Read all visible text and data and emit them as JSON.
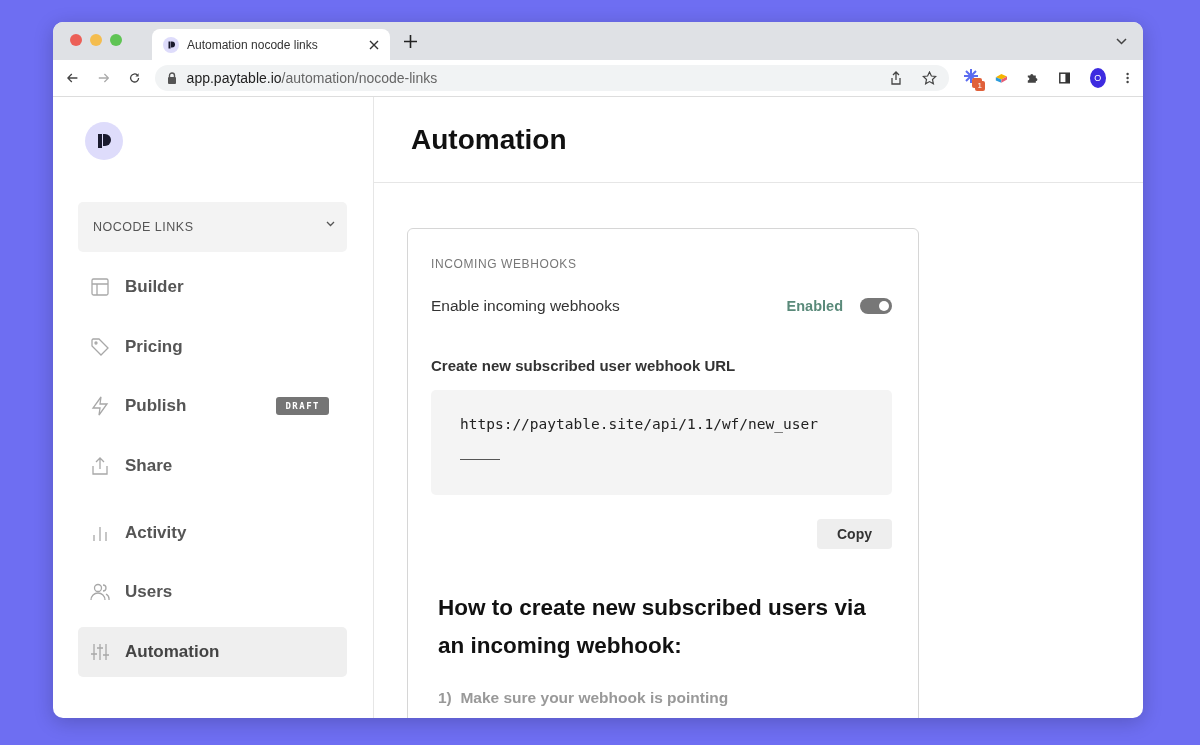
{
  "browser": {
    "tab_title": "Automation nocode links",
    "url_host": "app.paytable.io",
    "url_path": "/automation/nocode-links",
    "extension_badge": "1",
    "profile_initial": "O"
  },
  "sidebar": {
    "workspace": "NOCODE LINKS",
    "groups": [
      [
        {
          "label": "Builder",
          "selected": false
        },
        {
          "label": "Pricing",
          "selected": false
        },
        {
          "label": "Publish",
          "selected": false,
          "badge": "DRAFT"
        },
        {
          "label": "Share",
          "selected": false
        }
      ],
      [
        {
          "label": "Activity",
          "selected": false
        },
        {
          "label": "Users",
          "selected": false
        },
        {
          "label": "Automation",
          "selected": true
        }
      ]
    ]
  },
  "page": {
    "title": "Automation",
    "card": {
      "section_title": "INCOMING WEBHOOKS",
      "toggle_label": "Enable incoming webhooks",
      "toggle_status": "Enabled",
      "toggle_on": true,
      "url_label": "Create new subscribed user webhook URL",
      "url": "https://paytable.site/api/1.1/wf/new_user",
      "copy_button": "Copy",
      "heading": "How to create new subscribed users via an incoming webhook:",
      "step": "1)  Make sure your webhook is pointing"
    }
  }
}
